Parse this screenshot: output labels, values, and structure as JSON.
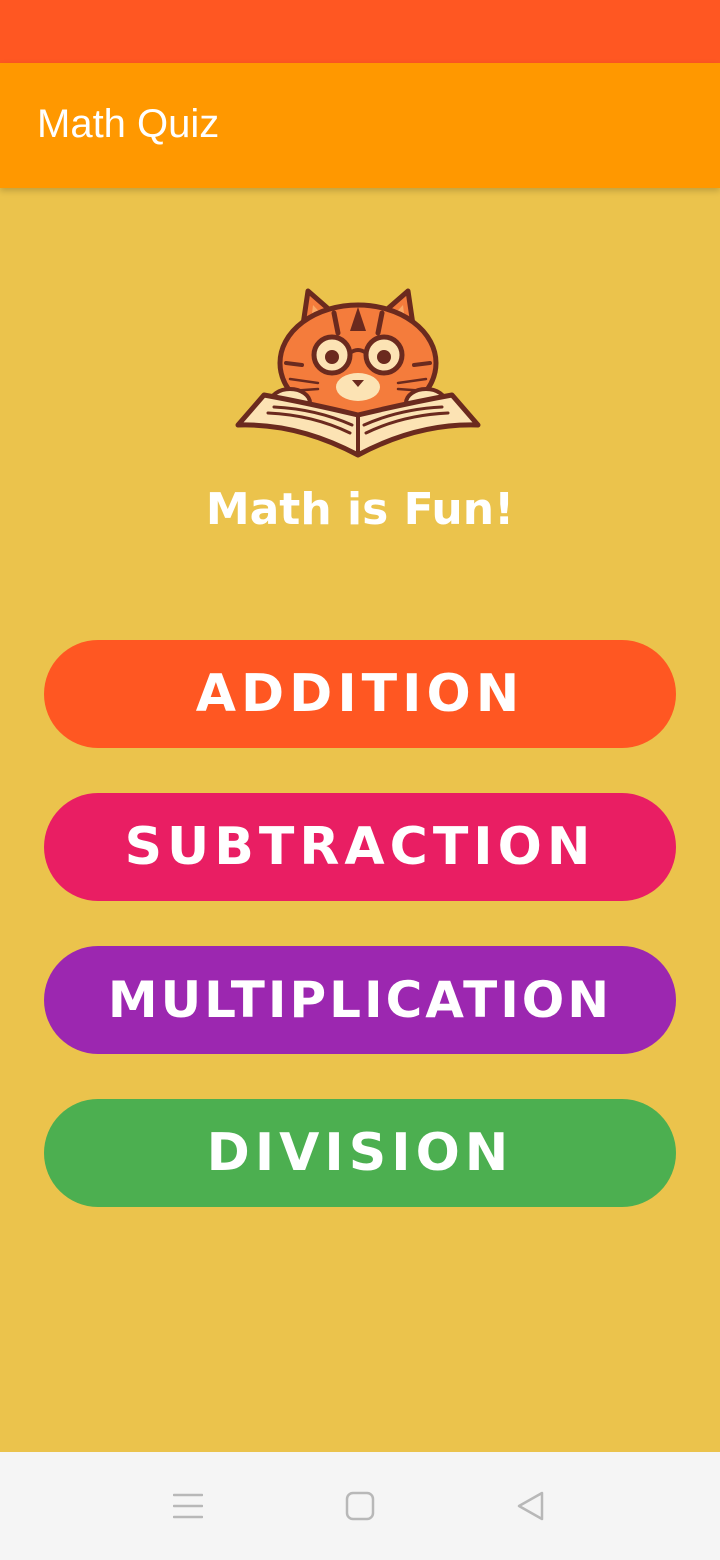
{
  "app_bar": {
    "title": "Math Quiz"
  },
  "hero": {
    "tagline": "Math is Fun!",
    "mascot_icon": "cat-reading-book-icon"
  },
  "buttons": [
    {
      "label": "ADDITION",
      "color": "#FF5722"
    },
    {
      "label": "SUBTRACTION",
      "color": "#E91E63"
    },
    {
      "label": "MULTIPLICATION",
      "color": "#9C27B0"
    },
    {
      "label": "DIVISION",
      "color": "#4CAF50"
    }
  ],
  "colors": {
    "status_bar": "#FF5722",
    "app_bar": "#FF9800",
    "background": "#EBC34C",
    "nav_bar": "#F5F5F5"
  },
  "nav": {
    "menu_icon": "menu-icon",
    "home_icon": "home-icon",
    "back_icon": "back-icon"
  }
}
